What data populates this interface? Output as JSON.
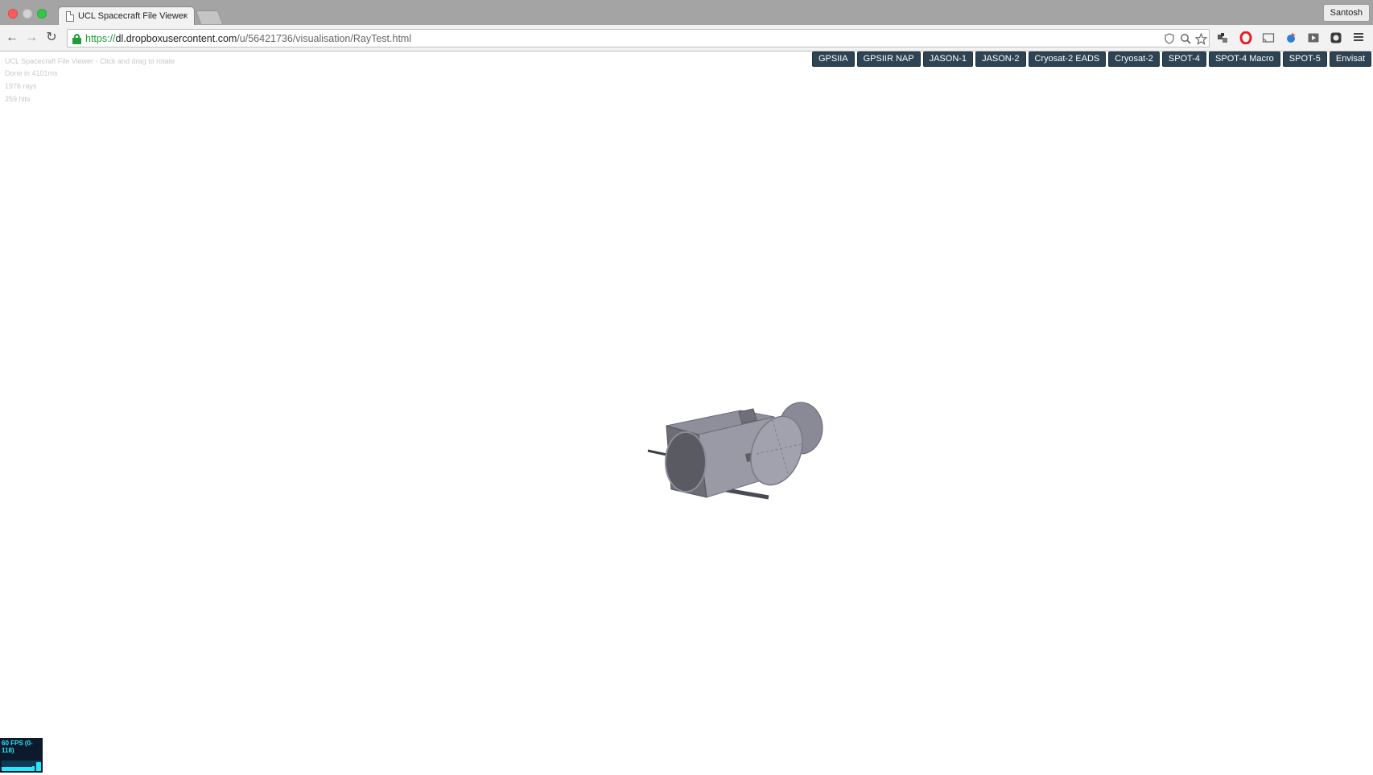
{
  "browser": {
    "tab_title": "UCL Spacecraft File Viewer",
    "tab_close": "×",
    "profile_name": "Santosh",
    "url_scheme": "https://",
    "url_host": "dl.dropboxusercontent.com",
    "url_path": "/u/56421736/visualisation/RayTest.html",
    "icons": [
      "back-arrow-icon",
      "forward-arrow-icon",
      "reload-icon",
      "lock-icon",
      "shield-icon",
      "zoom-icon",
      "star-icon",
      "extension-icon",
      "opera-icon",
      "cast-icon",
      "bird-icon",
      "video-icon",
      "shield-dark-icon",
      "menu-icon"
    ]
  },
  "viewer": {
    "title": "UCL Spacecraft File Viewer - Click and drag to rotate",
    "status": "Done in 4101ms",
    "rays": "1976 rays",
    "hits": "259 hits"
  },
  "models": {
    "buttons": [
      "GPSIIA",
      "GPSIIR NAP",
      "JASON-1",
      "JASON-2",
      "Cryosat-2 EADS",
      "Cryosat-2",
      "SPOT-4",
      "SPOT-4 Macro",
      "SPOT-5",
      "Envisat"
    ]
  },
  "stats": {
    "fps_label": "60 FPS (0-118)",
    "fps": 60,
    "fps_min": 0,
    "fps_max": 118
  },
  "colors": {
    "button_bg": "#2e4353",
    "model_gray": "#8a8a94",
    "fps_text": "#26e8ff"
  }
}
